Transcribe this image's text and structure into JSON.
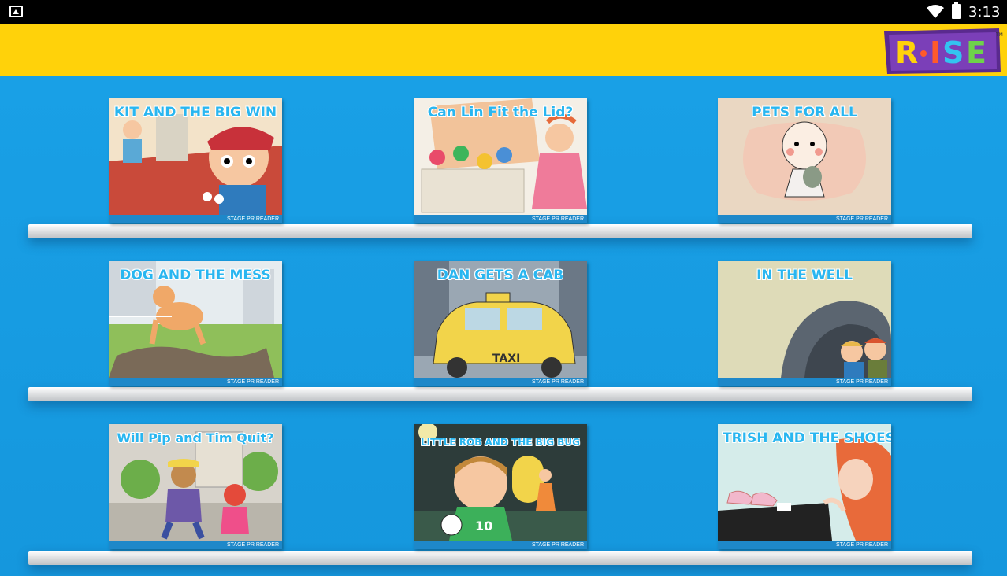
{
  "status_bar": {
    "time": "3:13",
    "icons": [
      "image-notification-icon",
      "wifi-icon",
      "battery-icon"
    ]
  },
  "app_bar": {
    "logo_text": "RISE",
    "logo_tm": "TM"
  },
  "books": [
    {
      "title": "KIT AND THE BIG WIN",
      "badge": "STAGE PR READER",
      "color": "#c94a3a"
    },
    {
      "title": "Can Lin Fit the Lid?",
      "badge": "STAGE PR READER",
      "color": "#e7d2b8"
    },
    {
      "title": "PETS FOR ALL",
      "badge": "STAGE PR READER",
      "color": "#ead7c2"
    },
    {
      "title": "DOG AND THE MESS",
      "badge": "STAGE PR READER",
      "color": "#8fbf5a"
    },
    {
      "title": "DAN GETS A CAB",
      "badge": "STAGE PR READER",
      "color": "#9aa7b3"
    },
    {
      "title": "IN THE WELL",
      "badge": "STAGE PR READER",
      "color": "#c8c7a0"
    },
    {
      "title": "Will Pip and Tim Quit?",
      "badge": "STAGE PR READER",
      "color": "#c9c3b6"
    },
    {
      "title": "LITTLE ROB AND THE BIG BUG",
      "badge": "STAGE PR READER",
      "color": "#3c4d44"
    },
    {
      "title": "TRISH AND THE SHOES",
      "badge": "STAGE PR READER",
      "color": "#cfe6e3"
    }
  ]
}
